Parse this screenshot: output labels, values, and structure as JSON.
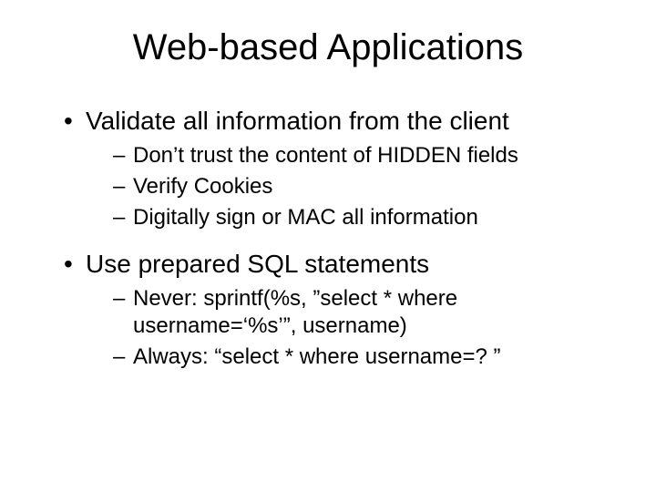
{
  "title": "Web-based Applications",
  "bullets": [
    {
      "text": "Validate all information from the client",
      "sub": [
        "Don’t trust the content of HIDDEN fields",
        "Verify Cookies",
        "Digitally sign or MAC all information"
      ]
    },
    {
      "text": "Use prepared SQL statements",
      "sub": [
        "Never:  sprintf(%s, ”select * where username=‘%s’”, username)",
        "Always: “select * where username=? ”"
      ]
    }
  ]
}
